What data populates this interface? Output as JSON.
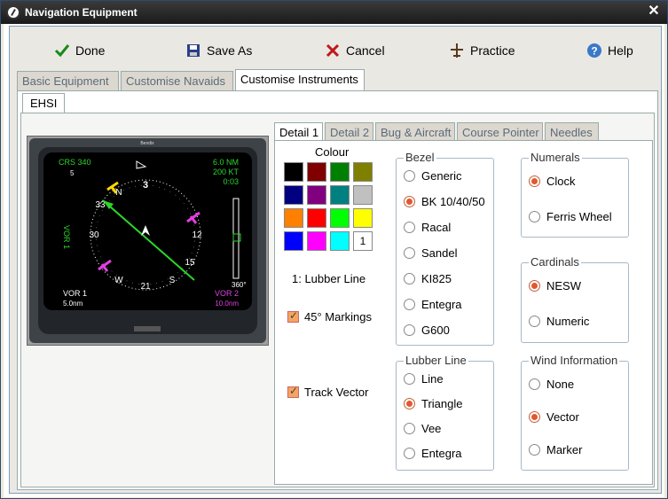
{
  "window": {
    "title": "Navigation Equipment"
  },
  "toolbar": {
    "done": "Done",
    "save_as": "Save As",
    "cancel": "Cancel",
    "practice": "Practice",
    "help": "Help"
  },
  "main_tabs": [
    "Basic Equipment",
    "Customise Navaids",
    "Customise Instruments"
  ],
  "instrument_tab": "EHSI",
  "detail_tabs": [
    "Detail 1",
    "Detail 2",
    "Bug & Aircraft",
    "Course Pointer",
    "Needles"
  ],
  "ehsi": {
    "brand": "Bendix",
    "hdg": "CRS 340",
    "hdg_sub": "5",
    "dist_top": "6.0 NM",
    "speed": "200 KT",
    "time": "0:03",
    "left_label": "VOR 1",
    "right_label": "360°",
    "bottom_left_1": "VOR 1",
    "bottom_left_2": "5.0nm",
    "bottom_right_1": "VOR 2",
    "bottom_right_2": "10.0nm"
  },
  "colour": {
    "label": "Colour",
    "swatches": [
      "#000000",
      "#800000",
      "#008000",
      "#808000",
      "#000080",
      "#800080",
      "#008080",
      "#c0c0c0",
      "#ff8000",
      "#ff0000",
      "#00ff00",
      "#ffff00",
      "#0000ff",
      "#ff00ff",
      "#00ffff",
      "#ffffff"
    ],
    "selected_number": "1",
    "lubber_line_text": "1: Lubber Line"
  },
  "checkboxes": {
    "markings_45": "45° Markings",
    "track_vector": "Track Vector"
  },
  "bezel": {
    "title": "Bezel",
    "options": [
      "Generic",
      "BK 10/40/50",
      "Racal",
      "Sandel",
      "KI825",
      "Entegra",
      "G600"
    ],
    "selected": "BK 10/40/50"
  },
  "numerals": {
    "title": "Numerals",
    "options": [
      "Clock",
      "Ferris Wheel"
    ],
    "selected": "Clock"
  },
  "cardinals": {
    "title": "Cardinals",
    "options": [
      "NESW",
      "Numeric"
    ],
    "selected": "NESW"
  },
  "lubber_line": {
    "title": "Lubber Line",
    "options": [
      "Line",
      "Triangle",
      "Vee",
      "Entegra"
    ],
    "selected": "Triangle"
  },
  "wind_information": {
    "title": "Wind Information",
    "options": [
      "None",
      "Vector",
      "Marker"
    ],
    "selected": "Vector"
  }
}
